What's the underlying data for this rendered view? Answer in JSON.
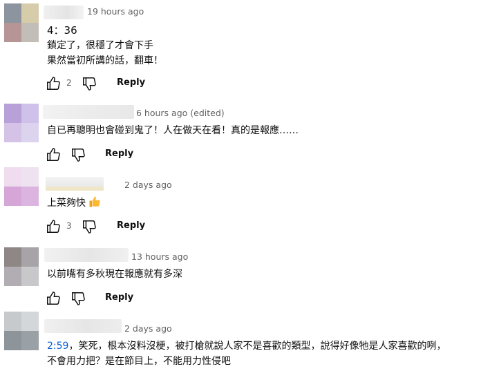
{
  "comments": [
    {
      "timestamp": "19 hours ago",
      "lines": [
        "4：36",
        "鎖定了，很穩了才會下手",
        "果然當初所講的話，翻車！"
      ],
      "likes": "2",
      "reply": "Reply",
      "avatar_colors": [
        "#8c959f",
        "#d6ccaa",
        "#b79495",
        "#c3bdb8"
      ],
      "name_blur": [
        "#f0f0f0",
        "#e4e4e4",
        "#f3f3f3"
      ]
    },
    {
      "timestamp": "6 hours ago (edited)",
      "lines": [
        "自已再聰明也會碰到鬼了！人在做天在看！真的是報應……"
      ],
      "likes": "",
      "reply": "Reply",
      "avatar_colors": [
        "#b8a1d8",
        "#cfc1e9",
        "#d4c3e6",
        "#dcd3ee"
      ],
      "name_blur": [
        "#f2f2f2",
        "#ececec",
        "#e8e8e8"
      ]
    },
    {
      "timestamp": "2 days ago",
      "lines_text": "上菜夠快",
      "likes": "3",
      "reply": "Reply",
      "avatar_colors": [
        "#f0dcef",
        "#efe2f0",
        "#d6a6d9",
        "#dcb4e0"
      ],
      "name_blur": [
        "#f3f3f3",
        "#e9e9e9",
        "#efe6c7"
      ]
    },
    {
      "timestamp": "13 hours ago",
      "lines": [
        "以前嘴有多秋現在報應就有多深"
      ],
      "likes": "",
      "reply": "Reply",
      "avatar_colors": [
        "#8f8786",
        "#a7a3a6",
        "#b1adb2",
        "#c8c8ca"
      ],
      "name_blur": [
        "#f1f1f1",
        "#e6e6e6",
        "#f0f0f0"
      ]
    },
    {
      "timestamp": "2 days ago",
      "ts_link": "2:59",
      "line1_rest": "，笑死，根本沒料沒梗，被打槍就說人家不是喜歡的類型，說得好像牠是人家喜歡的咧，",
      "line2": "不會用力把？是在節目上，不能用力性侵吧",
      "avatar_colors": [
        "#c6cacd",
        "#d4d7da",
        "#8d959a",
        "#9aa1a6"
      ],
      "name_blur": [
        "#f0f0f0",
        "#e6e6e6",
        "#ededed"
      ]
    }
  ]
}
